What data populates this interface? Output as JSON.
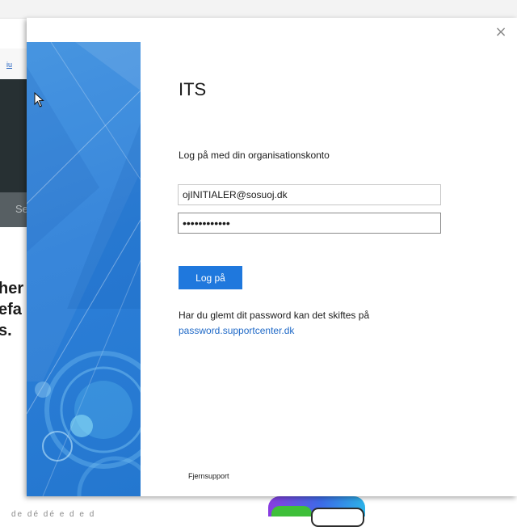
{
  "background": {
    "nav_link": "iu",
    "search_fragment": "Se",
    "heading_lines": [
      "her",
      "efa",
      "s."
    ],
    "bottom_text": "de dé dé e d e d"
  },
  "dialog": {
    "close_symbol": "×",
    "title": "ITS",
    "subtitle": "Log på med din organisationskonto",
    "email_value": "ojINITIALER@sosuoj.dk",
    "password_value": "passwordpass",
    "login_button": "Log på",
    "help_text": "Har du glemt dit password kan det skiftes på",
    "help_link": "password.supportcenter.dk",
    "remote_support": "Fjernsupport"
  },
  "colors": {
    "side_panel": "#2c7fd8",
    "button": "#1f78dd",
    "link": "#1f69c7"
  }
}
